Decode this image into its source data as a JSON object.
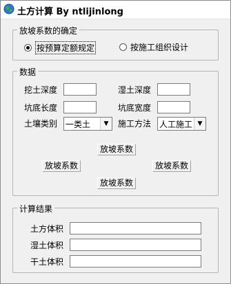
{
  "window": {
    "title": "土方计算 By ntlijinlong"
  },
  "slope_group": {
    "legend": "放坡系数的确定",
    "option1": "按预算定额规定",
    "option2": "按施工组织设计",
    "selected": "option1"
  },
  "data_group": {
    "legend": "数据",
    "dig_depth_label": "挖土深度",
    "wet_depth_label": "湿土深度",
    "pit_length_label": "坑底长度",
    "pit_width_label": "坑底宽度",
    "soil_type_label": "土壤类别",
    "soil_type_value": "一类土",
    "method_label": "施工方法",
    "method_value": "人工施工",
    "slope_top": "放坡系数",
    "slope_left": "放坡系数",
    "slope_right": "放坡系数",
    "slope_bottom": "放坡系数"
  },
  "result_group": {
    "legend": "计算结果",
    "earth_volume_label": "土方体积",
    "wet_volume_label": "湿土体积",
    "dry_volume_label": "干土体积"
  },
  "colors": {
    "window_bg": "#f0f0f0",
    "border": "#b5b5b5"
  },
  "icons": {
    "app": "globe-icon",
    "dropdown": "chevron-down-icon"
  }
}
